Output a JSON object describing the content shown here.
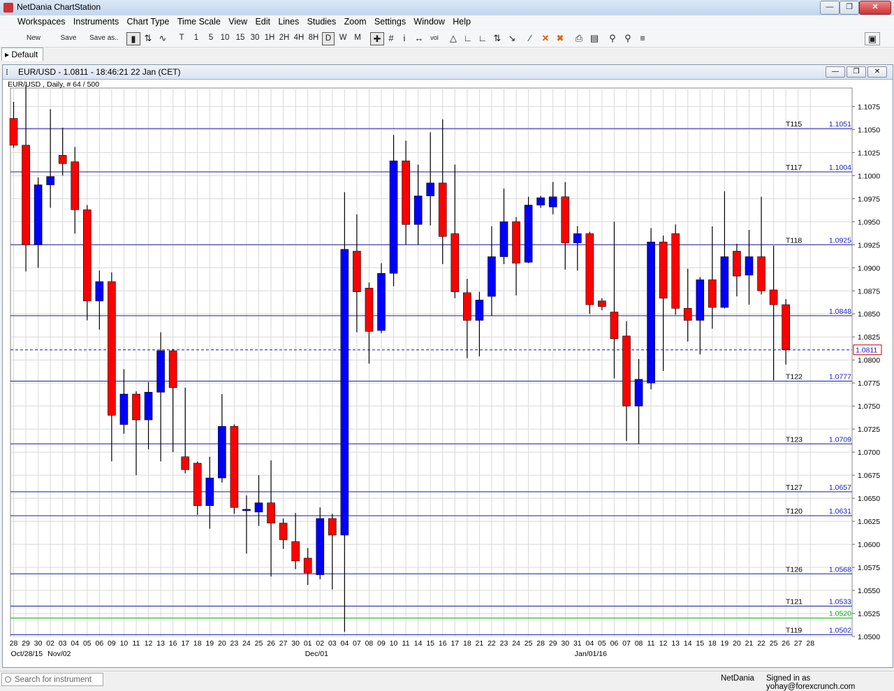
{
  "app": {
    "title": "NetDania ChartStation"
  },
  "menu": [
    "Workspaces",
    "Instruments",
    "Chart Type",
    "Time Scale",
    "View",
    "Edit",
    "Lines",
    "Studies",
    "Zoom",
    "Settings",
    "Window",
    "Help"
  ],
  "toolbar": {
    "new": "New",
    "save": "Save",
    "save_as": "Save as..",
    "timescales": [
      "T",
      "1",
      "5",
      "10",
      "15",
      "30",
      "1H",
      "2H",
      "4H",
      "8H",
      "D",
      "W",
      "M"
    ],
    "selected_timescale": "D"
  },
  "tabs": [
    {
      "label": "Default"
    }
  ],
  "chart_window": {
    "caption": "EUR/USD - 1.0811 - 18:46:21  22 Jan (CET)",
    "info": "EUR/USD , Daily, # 64 / 500"
  },
  "chart_data": {
    "type": "candlestick",
    "y_ticks": [
      "1.0500",
      "1.0525",
      "1.0550",
      "1.0575",
      "1.0600",
      "1.0625",
      "1.0650",
      "1.0675",
      "1.0700",
      "1.0725",
      "1.0750",
      "1.0775",
      "1.0800",
      "1.0825",
      "1.0850",
      "1.0875",
      "1.0900",
      "1.0925",
      "1.0950",
      "1.0975",
      "1.1000",
      "1.1025",
      "1.1050",
      "1.1075"
    ],
    "ylim": [
      1.05,
      1.1095
    ],
    "x_tick_labels": [
      "28",
      "29",
      "30",
      "02",
      "03",
      "04",
      "05",
      "06",
      "09",
      "10",
      "11",
      "12",
      "13",
      "16",
      "17",
      "18",
      "19",
      "20",
      "23",
      "24",
      "25",
      "26",
      "27",
      "30",
      "01",
      "02",
      "03",
      "04",
      "07",
      "08",
      "09",
      "10",
      "11",
      "14",
      "15",
      "16",
      "17",
      "18",
      "21",
      "22",
      "23",
      "24",
      "25",
      "28",
      "29",
      "30",
      "31",
      "04",
      "05",
      "06",
      "07",
      "08",
      "11",
      "12",
      "13",
      "14",
      "15",
      "18",
      "19",
      "20",
      "21",
      "22",
      "25",
      "26",
      "27",
      "28"
    ],
    "month_labels": [
      {
        "label": "Oct/28/15",
        "index": 0
      },
      {
        "label": "Nov/02",
        "index": 3
      },
      {
        "label": "Dec/01",
        "index": 24
      },
      {
        "label": "Jan/01/16",
        "index": 46
      }
    ],
    "candles": [
      {
        "o": 1.1062,
        "h": 1.108,
        "l": 1.103,
        "c": 1.1033
      },
      {
        "o": 1.1033,
        "h": 1.1098,
        "l": 1.0896,
        "c": 1.0925
      },
      {
        "o": 1.0925,
        "h": 1.0998,
        "l": 1.09,
        "c": 1.099
      },
      {
        "o": 1.099,
        "h": 1.1072,
        "l": 1.0965,
        "c": 1.0999
      },
      {
        "o": 1.1022,
        "h": 1.1052,
        "l": 1.1,
        "c": 1.1013
      },
      {
        "o": 1.1015,
        "h": 1.1031,
        "l": 1.0937,
        "c": 1.0963
      },
      {
        "o": 1.0963,
        "h": 1.0968,
        "l": 1.0843,
        "c": 1.0864
      },
      {
        "o": 1.0864,
        "h": 1.0897,
        "l": 1.0833,
        "c": 1.0885
      },
      {
        "o": 1.0885,
        "h": 1.0895,
        "l": 1.069,
        "c": 1.074
      },
      {
        "o": 1.073,
        "h": 1.079,
        "l": 1.072,
        "c": 1.0763
      },
      {
        "o": 1.0763,
        "h": 1.0766,
        "l": 1.0675,
        "c": 1.0735
      },
      {
        "o": 1.0735,
        "h": 1.0776,
        "l": 1.0703,
        "c": 1.0765
      },
      {
        "o": 1.0765,
        "h": 1.083,
        "l": 1.069,
        "c": 1.081
      },
      {
        "o": 1.081,
        "h": 1.0812,
        "l": 1.07,
        "c": 1.077
      },
      {
        "o": 1.0695,
        "h": 1.077,
        "l": 1.0677,
        "c": 1.0681
      },
      {
        "o": 1.0688,
        "h": 1.069,
        "l": 1.0632,
        "c": 1.0642
      },
      {
        "o": 1.0642,
        "h": 1.0695,
        "l": 1.0617,
        "c": 1.0672
      },
      {
        "o": 1.0672,
        "h": 1.0763,
        "l": 1.0667,
        "c": 1.0728
      },
      {
        "o": 1.0728,
        "h": 1.073,
        "l": 1.0633,
        "c": 1.064
      },
      {
        "o": 1.0637,
        "h": 1.0653,
        "l": 1.059,
        "c": 1.0638
      },
      {
        "o": 1.0635,
        "h": 1.0675,
        "l": 1.062,
        "c": 1.0645
      },
      {
        "o": 1.0645,
        "h": 1.0691,
        "l": 1.0565,
        "c": 1.0623
      },
      {
        "o": 1.0623,
        "h": 1.0628,
        "l": 1.0595,
        "c": 1.0605
      },
      {
        "o": 1.0603,
        "h": 1.0634,
        "l": 1.0573,
        "c": 1.0582
      },
      {
        "o": 1.0585,
        "h": 1.0596,
        "l": 1.0556,
        "c": 1.0569
      },
      {
        "o": 1.0567,
        "h": 1.064,
        "l": 1.0562,
        "c": 1.0628
      },
      {
        "o": 1.0628,
        "h": 1.0633,
        "l": 1.0551,
        "c": 1.061
      },
      {
        "o": 1.061,
        "h": 1.0982,
        "l": 1.0505,
        "c": 1.092
      },
      {
        "o": 1.0918,
        "h": 1.0958,
        "l": 1.083,
        "c": 1.0874
      },
      {
        "o": 1.0878,
        "h": 1.0884,
        "l": 1.0796,
        "c": 1.0831
      },
      {
        "o": 1.0832,
        "h": 1.0905,
        "l": 1.0829,
        "c": 1.0894
      },
      {
        "o": 1.0894,
        "h": 1.1044,
        "l": 1.088,
        "c": 1.1016
      },
      {
        "o": 1.1016,
        "h": 1.1038,
        "l": 1.0925,
        "c": 1.0947
      },
      {
        "o": 1.0947,
        "h": 1.1012,
        "l": 1.0925,
        "c": 1.0978
      },
      {
        "o": 1.0978,
        "h": 1.1047,
        "l": 1.0946,
        "c": 1.0992
      },
      {
        "o": 1.0992,
        "h": 1.1061,
        "l": 1.0904,
        "c": 1.0934
      },
      {
        "o": 1.0937,
        "h": 1.1012,
        "l": 1.0867,
        "c": 1.0874
      },
      {
        "o": 1.0873,
        "h": 1.0888,
        "l": 1.0802,
        "c": 1.0843
      },
      {
        "o": 1.0843,
        "h": 1.0874,
        "l": 1.0804,
        "c": 1.0865
      },
      {
        "o": 1.0869,
        "h": 1.0945,
        "l": 1.0848,
        "c": 1.0912
      },
      {
        "o": 1.0912,
        "h": 1.0986,
        "l": 1.0904,
        "c": 1.095
      },
      {
        "o": 1.095,
        "h": 1.0955,
        "l": 1.087,
        "c": 1.0905
      },
      {
        "o": 1.0906,
        "h": 1.0977,
        "l": 1.0905,
        "c": 1.0968
      },
      {
        "o": 1.0968,
        "h": 1.0978,
        "l": 1.0965,
        "c": 1.0976
      },
      {
        "o": 1.0966,
        "h": 1.0993,
        "l": 1.0958,
        "c": 1.0977
      },
      {
        "o": 1.0977,
        "h": 1.0993,
        "l": 1.0898,
        "c": 1.0927
      },
      {
        "o": 1.0927,
        "h": 1.0945,
        "l": 1.0897,
        "c": 1.0937
      },
      {
        "o": 1.0937,
        "h": 1.0939,
        "l": 1.085,
        "c": 1.086
      },
      {
        "o": 1.0864,
        "h": 1.0867,
        "l": 1.0854,
        "c": 1.0858
      },
      {
        "o": 1.0852,
        "h": 1.095,
        "l": 1.078,
        "c": 1.0823
      },
      {
        "o": 1.0826,
        "h": 1.0842,
        "l": 1.0712,
        "c": 1.075
      },
      {
        "o": 1.075,
        "h": 1.0801,
        "l": 1.0709,
        "c": 1.0779
      },
      {
        "o": 1.0775,
        "h": 1.0943,
        "l": 1.0768,
        "c": 1.0928
      },
      {
        "o": 1.0928,
        "h": 1.0935,
        "l": 1.0788,
        "c": 1.0867
      },
      {
        "o": 1.0937,
        "h": 1.0947,
        "l": 1.0849,
        "c": 1.0856
      },
      {
        "o": 1.0856,
        "h": 1.0899,
        "l": 1.082,
        "c": 1.0843
      },
      {
        "o": 1.0843,
        "h": 1.089,
        "l": 1.0806,
        "c": 1.0887
      },
      {
        "o": 1.0887,
        "h": 1.0945,
        "l": 1.0834,
        "c": 1.0857
      },
      {
        "o": 1.0857,
        "h": 1.0983,
        "l": 1.0856,
        "c": 1.0912
      },
      {
        "o": 1.0918,
        "h": 1.0926,
        "l": 1.0869,
        "c": 1.0891
      },
      {
        "o": 1.0892,
        "h": 1.0941,
        "l": 1.086,
        "c": 1.0912
      },
      {
        "o": 1.0912,
        "h": 1.0977,
        "l": 1.0871,
        "c": 1.0875
      },
      {
        "o": 1.0876,
        "h": 1.0924,
        "l": 1.0778,
        "c": 1.086
      },
      {
        "o": 1.086,
        "h": 1.0866,
        "l": 1.0795,
        "c": 1.0811
      }
    ],
    "h_lines": [
      {
        "label": "T115",
        "value": "1.1051",
        "v": 1.1051
      },
      {
        "label": "T117",
        "value": "1.1004",
        "v": 1.1004
      },
      {
        "label": "T118",
        "value": "1.0925",
        "v": 1.0925
      },
      {
        "label": "",
        "value": "1.0848",
        "v": 1.0848
      },
      {
        "label": "T122",
        "value": "1.0777",
        "v": 1.0777
      },
      {
        "label": "T123",
        "value": "1.0709",
        "v": 1.0709
      },
      {
        "label": "T127",
        "value": "1.0657",
        "v": 1.0657
      },
      {
        "label": "T120",
        "value": "1.0631",
        "v": 1.0631
      },
      {
        "label": "T126",
        "value": "1.0568",
        "v": 1.0568
      },
      {
        "label": "T121",
        "value": "1.0533",
        "v": 1.0533
      },
      {
        "label": "T119",
        "value": "1.0502",
        "v": 1.0502
      }
    ],
    "green_line": {
      "value": "1.0520",
      "v": 1.052
    },
    "current_price": {
      "value": "1.0811",
      "v": 1.0811
    },
    "colors": {
      "up": "#0000ff",
      "down": "#ff0000",
      "line": "#1a1aa0",
      "green": "#00b000",
      "grid": "#d8d8d8"
    }
  },
  "status": {
    "search_placeholder": "Search for instrument",
    "brand": "NetDania",
    "signed_in": "Signed in as yohay@forexcrunch.com"
  }
}
